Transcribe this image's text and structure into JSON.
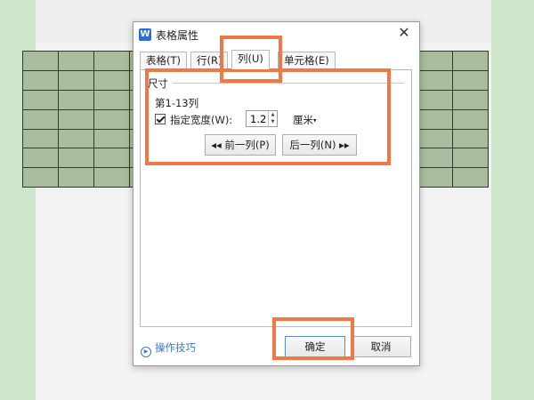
{
  "dialog": {
    "app_icon": "W",
    "title": "表格属性",
    "close_glyph": "✕"
  },
  "tabs": [
    {
      "label": "表格(T)",
      "active": false
    },
    {
      "label": "行(R)",
      "active": false
    },
    {
      "label": "列(U)",
      "active": true
    },
    {
      "label": "单元格(E)",
      "active": false
    }
  ],
  "size_group": {
    "legend": "尺寸",
    "range": "第1-13列",
    "specify_width_label": "指定宽度(W):",
    "specify_width_checked": true,
    "width_value": "1.2",
    "unit": "厘米",
    "unit_caret": "▾",
    "prev_button": "◂◂ 前一列(P)",
    "next_button": "后一列(N) ▸▸"
  },
  "footer": {
    "tips_label": "操作技巧",
    "ok_button": "确定",
    "cancel_button": "取消"
  },
  "colors": {
    "highlight": "#f07845",
    "table_fill": "#a8bd9d",
    "tips_link": "#3b78c4"
  }
}
